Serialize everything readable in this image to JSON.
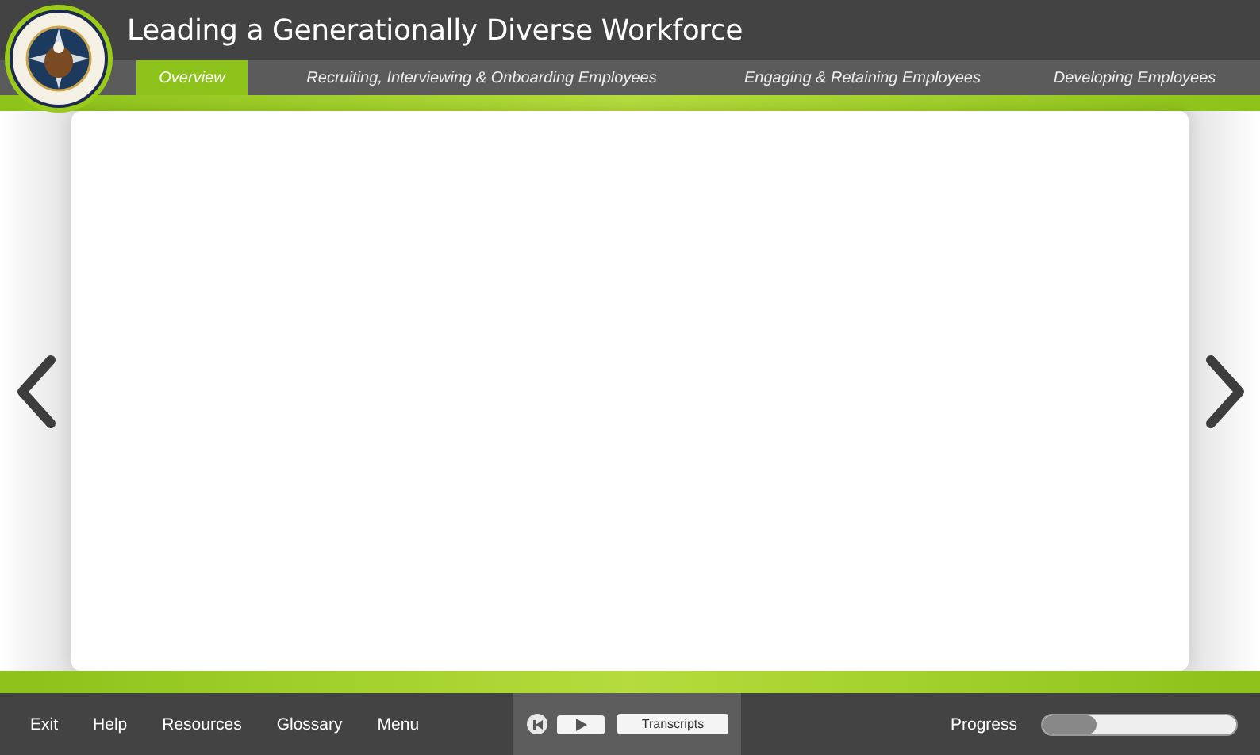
{
  "header": {
    "title": "Leading a Generationally Diverse Workforce"
  },
  "tabs": [
    {
      "label": "Overview",
      "selected": true
    },
    {
      "label": "Recruiting, Interviewing & Onboarding Employees",
      "selected": false
    },
    {
      "label": "Engaging & Retaining Employees",
      "selected": false
    },
    {
      "label": "Developing Employees",
      "selected": false
    }
  ],
  "footer": {
    "links": [
      "Exit",
      "Help",
      "Resources",
      "Glossary",
      "Menu"
    ],
    "transcripts_button": "Transcripts",
    "progress": {
      "label": "Progress",
      "level": 0.28
    }
  }
}
